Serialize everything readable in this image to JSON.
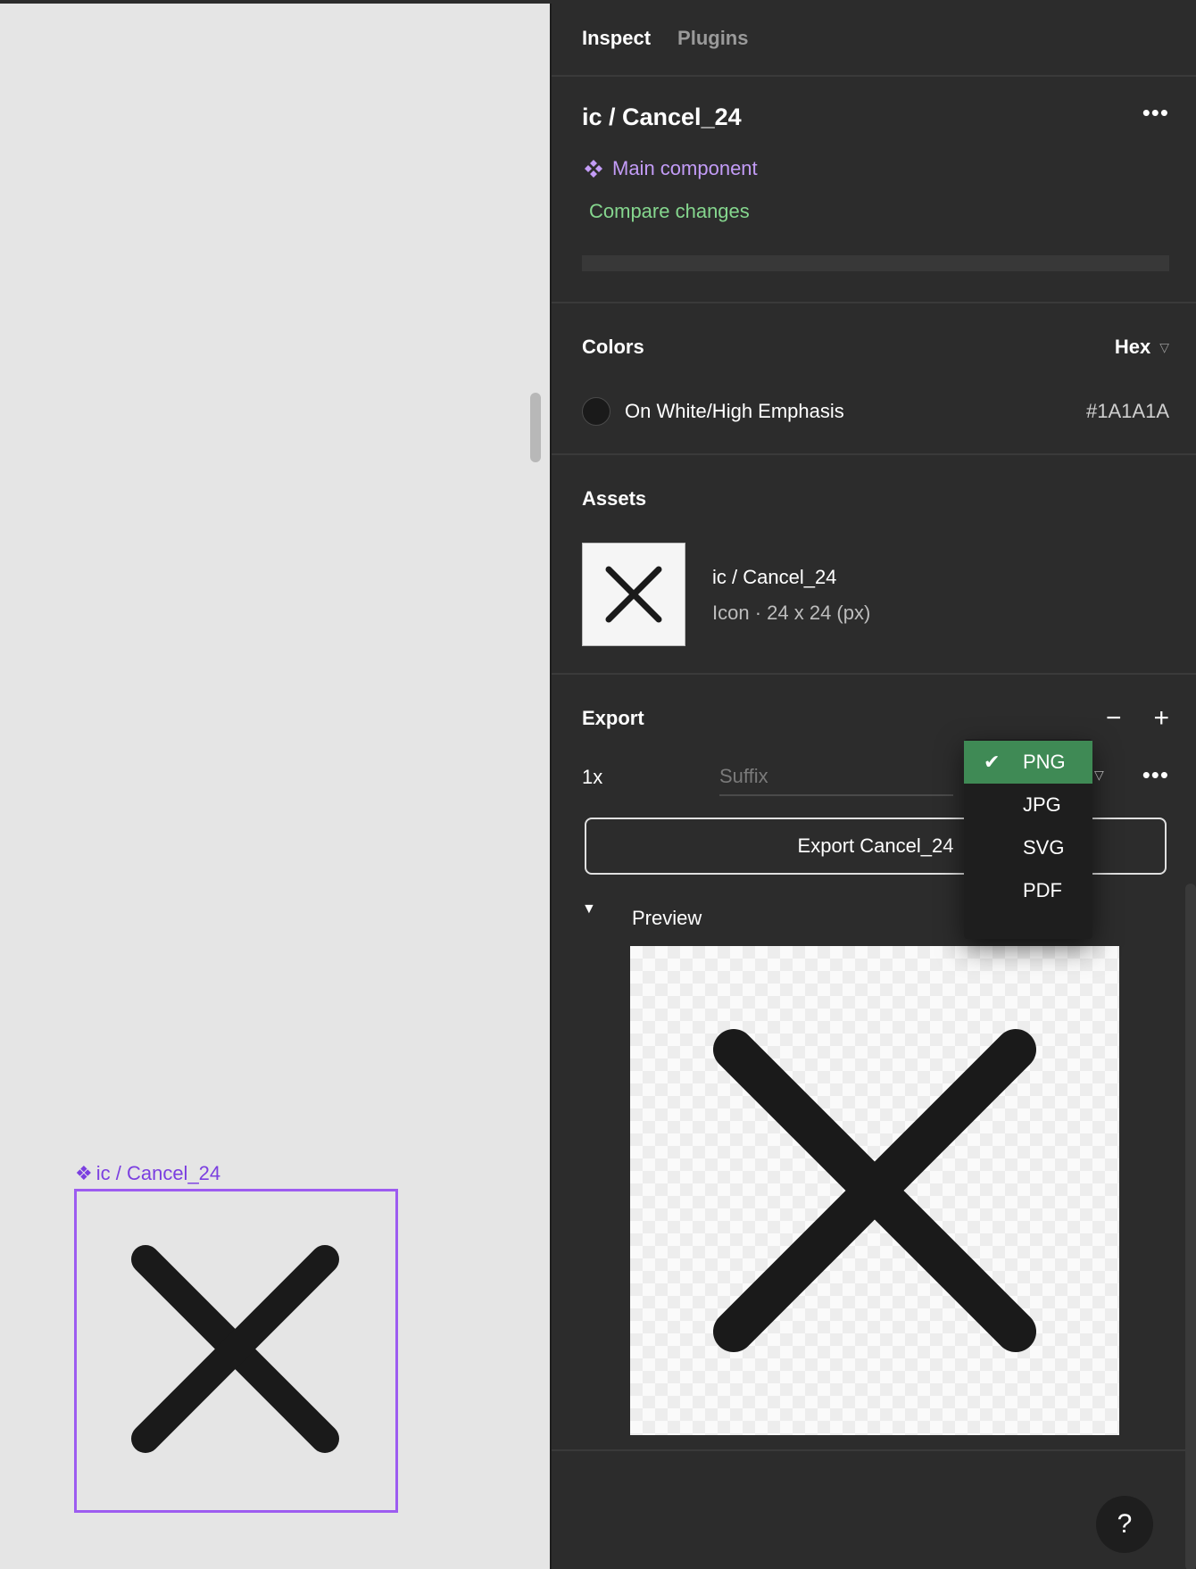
{
  "canvas": {
    "frame_label": "ic / Cancel_24",
    "component_glyph": "❖"
  },
  "panel": {
    "tabs": [
      "Inspect",
      "Plugins"
    ],
    "layer": {
      "title": "ic / Cancel_24",
      "component_label": "Main component",
      "compare_link": "Compare changes"
    },
    "colors": {
      "title": "Colors",
      "format": "Hex",
      "items": [
        {
          "name": "On White/High Emphasis",
          "hex": "#1A1A1A",
          "swatch": "#1A1A1A"
        }
      ]
    },
    "assets": {
      "title": "Assets",
      "items": [
        {
          "name": "ic / Cancel_24",
          "meta": "Icon · 24 x 24 (px)"
        }
      ]
    },
    "export": {
      "title": "Export",
      "scale": "1x",
      "suffix_placeholder": "Suffix",
      "format_options": [
        "PNG",
        "JPG",
        "SVG",
        "PDF"
      ],
      "selected_format": "PNG",
      "button_label": "Export Cancel_24",
      "preview_label": "Preview"
    },
    "help": "?"
  },
  "colors": {
    "accent_purple": "#9D5CF0",
    "component_purple": "#C39CF7",
    "compare_green": "#85D68E",
    "menu_selected": "#3F8A55",
    "panel_bg": "#2C2C2C",
    "canvas_bg": "#E5E5E5",
    "icon": "#1A1A1A"
  },
  "icons": {
    "component": "component-icon",
    "cancel": "cancel-icon",
    "more": "more-icon",
    "remove": "minus-icon",
    "add": "plus-icon",
    "check": "check-icon",
    "disclosure": "triangle-down-icon"
  }
}
